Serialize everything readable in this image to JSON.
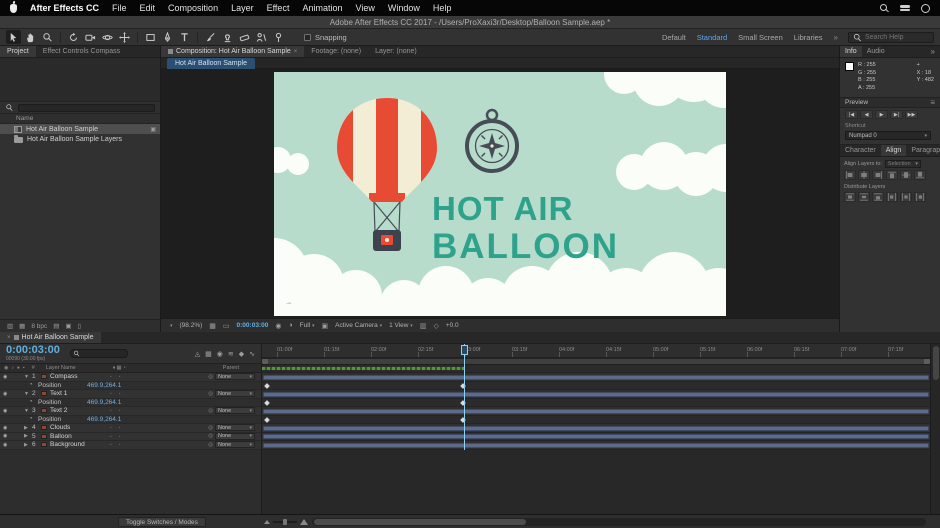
{
  "glyphs": {
    "overflow": "»",
    "dropdown": "▾",
    "close": "×"
  },
  "menubar": {
    "items": [
      "After Effects CC",
      "File",
      "Edit",
      "Composition",
      "Layer",
      "Effect",
      "Animation",
      "View",
      "Window",
      "Help"
    ]
  },
  "titlebar": {
    "title": "Adobe After Effects CC 2017 - /Users/ProXaxi3r/Desktop/Balloon Sample.aep *"
  },
  "toolbar": {
    "snapping_label": "Snapping",
    "workspaces": [
      "Default",
      "Standard",
      "Small Screen",
      "Libraries"
    ],
    "active_workspace": "Standard",
    "search_placeholder": "Search Help"
  },
  "project": {
    "tabs": [
      "Project",
      "Effect Controls Compass"
    ],
    "name_column": "Name",
    "items": [
      {
        "name": "Hot Air Balloon Sample",
        "type": "composition"
      },
      {
        "name": "Hot Air Balloon Sample Layers",
        "type": "folder"
      }
    ],
    "bpc": "8 bpc"
  },
  "viewer": {
    "tabs": [
      "Composition: Hot Air Balloon Sample",
      "Footage: (none)",
      "Layer: (none)"
    ],
    "comp_tab": "Hot Air Balloon Sample",
    "canvas": {
      "heading_line1": "HOT AIR",
      "heading_line2": "BALLOON",
      "bg_color": "#b7dccb",
      "heading_color": "#2fa28b",
      "balloon_red": "#e84b33",
      "balloon_cream": "#f3edd5",
      "outline_color": "#474d57"
    },
    "footer": {
      "zoom": "(98.2%)",
      "timecode": "0:00:03:00",
      "resolution": "Full",
      "camera": "Active Camera",
      "view_layout": "1 View",
      "exposure": "+0.0"
    }
  },
  "info": {
    "tabs": [
      "Info",
      "Audio"
    ],
    "r": "R : 255",
    "g": "G : 255",
    "b": "B : 255",
    "a": "A : 255",
    "x": "X : 18",
    "y": "Y : 482"
  },
  "preview": {
    "title": "Preview",
    "shortcut_label": "Shortcut",
    "shortcut_value": "Numpad 0"
  },
  "align": {
    "tabs": [
      "Character",
      "Align",
      "Paragraph"
    ],
    "active_tab": "Align",
    "align_layers_label": "Align Layers to:",
    "align_layers_value": "Selection",
    "distribute_label": "Distribute Layers"
  },
  "timeline": {
    "tab": "Hot Air Balloon Sample",
    "timecode": "0:00:03:00",
    "frame_info": "00090 (30.00 fps)",
    "header": {
      "number": "#",
      "layer_name": "Layer Name",
      "parent": "Parent"
    },
    "ruler": [
      "01:00f",
      "01:15f",
      "02:00f",
      "02:15f",
      "03:00f",
      "03:15f",
      "04:00f",
      "04:15f",
      "05:00f",
      "05:15f",
      "06:00f",
      "06:15f",
      "07:00f",
      "07:15f"
    ],
    "rows": [
      {
        "kind": "layer",
        "num": "1",
        "name": "Compass",
        "parent": "None"
      },
      {
        "kind": "prop",
        "name": "Position",
        "value": "469.9,264.1"
      },
      {
        "kind": "layer",
        "num": "2",
        "name": "Text 1",
        "parent": "None"
      },
      {
        "kind": "prop",
        "name": "Position",
        "value": "469.9,264.1"
      },
      {
        "kind": "layer",
        "num": "3",
        "name": "Text 2",
        "parent": "None"
      },
      {
        "kind": "prop",
        "name": "Position",
        "value": "469.9,264.1"
      },
      {
        "kind": "layer",
        "num": "4",
        "name": "Clouds",
        "parent": "None"
      },
      {
        "kind": "layer",
        "num": "5",
        "name": "Balloon",
        "parent": "None"
      },
      {
        "kind": "layer",
        "num": "6",
        "name": "Background",
        "parent": "None"
      }
    ],
    "toggle_label": "Toggle Switches / Modes"
  }
}
